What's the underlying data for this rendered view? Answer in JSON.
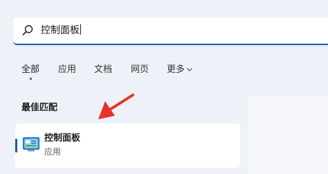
{
  "search": {
    "query": "控制面板",
    "icon": "search-icon"
  },
  "tabs": [
    {
      "label": "全部",
      "active": true
    },
    {
      "label": "应用",
      "active": false
    },
    {
      "label": "文档",
      "active": false
    },
    {
      "label": "网页",
      "active": false
    },
    {
      "label": "更多",
      "active": false,
      "icon": "chevron-down-icon"
    }
  ],
  "best_match": {
    "heading": "最佳匹配",
    "result": {
      "title": "控制面板",
      "subtitle": "应用",
      "icon": "control-panel-icon"
    }
  },
  "annotation": {
    "arrow_color": "#e8312a"
  },
  "colors": {
    "accent": "#005fb8",
    "background": "#eef1f7"
  }
}
